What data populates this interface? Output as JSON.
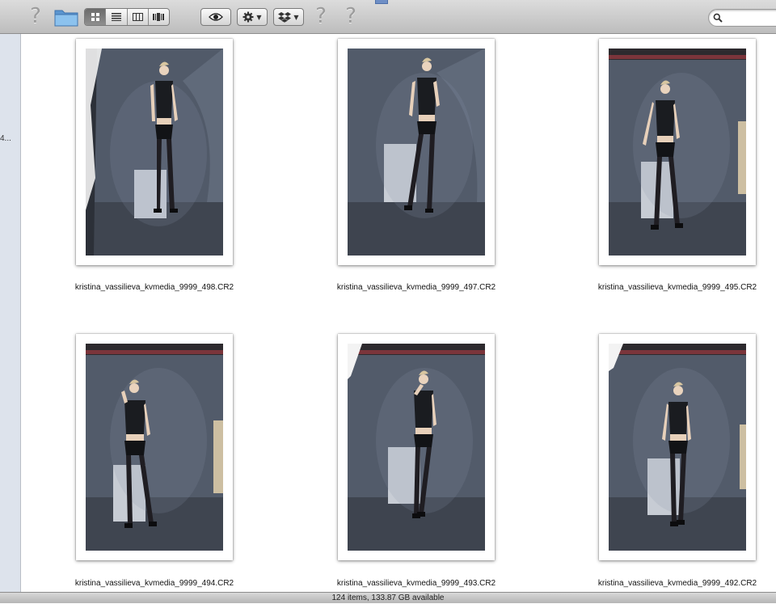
{
  "toolbar": {
    "icons": [
      "help-icon",
      "folder-icon",
      "icon-view-icon",
      "list-view-icon",
      "column-view-icon",
      "coverflow-view-icon",
      "quicklook-icon",
      "gear-icon",
      "dropbox-icon",
      "help-icon"
    ],
    "help_glyph": "?",
    "active_view": "icons",
    "search": {
      "value": "",
      "placeholder": ""
    }
  },
  "sidebar": {
    "item_label": "4..."
  },
  "files": [
    {
      "name": "kristina_vassilieva_kvmedia_9999_498.CR2"
    },
    {
      "name": "kristina_vassilieva_kvmedia_9999_497.CR2"
    },
    {
      "name": "kristina_vassilieva_kvmedia_9999_495.CR2"
    },
    {
      "name": "kristina_vassilieva_kvmedia_9999_494.CR2"
    },
    {
      "name": "kristina_vassilieva_kvmedia_9999_493.CR2"
    },
    {
      "name": "kristina_vassilieva_kvmedia_9999_492.CR2"
    }
  ],
  "status": {
    "text": "124 items, 133.87 GB available"
  },
  "colors": {
    "toolbar": "#c9c9c9",
    "sidebar": "#dde3ec",
    "folder_blue": "#6aa7dd",
    "photo_backdrop": "#4e5563"
  }
}
